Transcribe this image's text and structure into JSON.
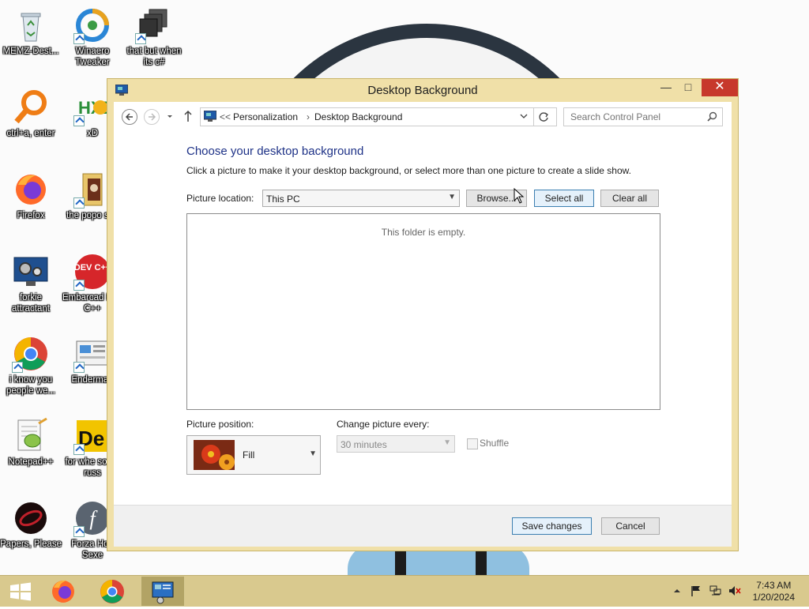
{
  "desktop": {
    "icons": [
      {
        "label": "MEMZ-Dest..."
      },
      {
        "label": "Winaero Tweaker"
      },
      {
        "label": "that but when its c#"
      },
      {
        "label": "ctrl+a, enter"
      },
      {
        "label": "xD"
      },
      {
        "label": "Firefox"
      },
      {
        "label": "the popo shit"
      },
      {
        "label": "forkie attractant"
      },
      {
        "label": "Embarcad Dev C++"
      },
      {
        "label": "i know you people we..."
      },
      {
        "label": "Enderman"
      },
      {
        "label": "Notepad++"
      },
      {
        "label": "for whe some russ"
      },
      {
        "label": "Papers, Please"
      },
      {
        "label": "Forza Hori Sexe"
      }
    ],
    "icon_badges": {
      "dev_badge": "DEV C++",
      "de_badge": "De",
      "f_badge": "f",
      "hx_badge": "HXD"
    }
  },
  "window": {
    "title": "Desktop Background",
    "controls": {
      "minimize": "—",
      "maximize": "□",
      "close": "✕"
    },
    "address": {
      "overflow": "<<",
      "crumbs": [
        "Personalization",
        "Desktop Background"
      ],
      "separator": "›"
    },
    "search": {
      "placeholder": "Search Control Panel"
    },
    "heading": "Choose your desktop background",
    "description": "Click a picture to make it your desktop background, or select more than one picture to create a slide show.",
    "picture_location": {
      "label": "Picture location:",
      "value": "This PC"
    },
    "buttons": {
      "browse": "Browse...",
      "select_all": "Select all",
      "clear_all": "Clear all",
      "save": "Save changes",
      "cancel": "Cancel"
    },
    "empty_message": "This folder is empty.",
    "picture_position": {
      "label": "Picture position:",
      "value": "Fill"
    },
    "change_every": {
      "label": "Change picture every:",
      "value": "30 minutes"
    },
    "shuffle": {
      "label": "Shuffle",
      "checked": false
    }
  },
  "taskbar": {
    "apps": [
      {
        "name": "start-button",
        "icon": "windows-logo"
      },
      {
        "name": "firefox",
        "icon": "firefox-icon"
      },
      {
        "name": "chrome",
        "icon": "chrome-icon"
      },
      {
        "name": "control-panel",
        "icon": "settings-icon",
        "active": true
      }
    ],
    "clock": {
      "time": "7:43 AM",
      "date": "1/20/2024"
    }
  },
  "colors": {
    "taskbar": "#d9c98e",
    "window_frame": "#f0e0a8",
    "heading": "#1e3287",
    "close": "#c7382b"
  }
}
